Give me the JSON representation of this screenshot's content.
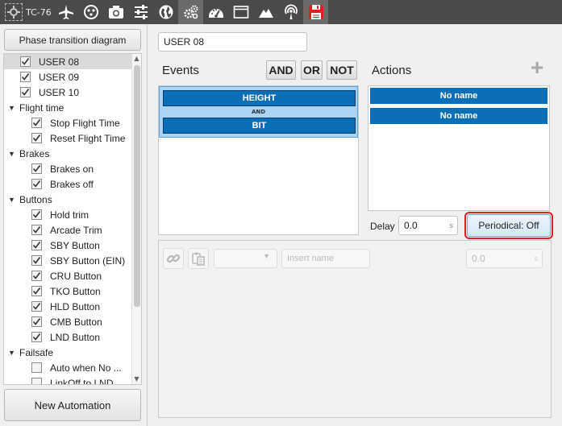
{
  "toolbar": {
    "app_name": "TC-76",
    "icons": [
      "airplane-icon",
      "circle-dots-icon",
      "camera-icon",
      "sliders-icon",
      "globe-icon",
      "gears-icon",
      "gauge-icon",
      "window-icon",
      "mountain-icon",
      "antenna-icon",
      "save-icon"
    ],
    "accent_save": "#e02020"
  },
  "left": {
    "phase_button": "Phase transition diagram",
    "new_automation": "New Automation",
    "tree": [
      {
        "type": "item",
        "label": "USER 08",
        "checked": true,
        "selected": true
      },
      {
        "type": "item",
        "label": "USER 09",
        "checked": true
      },
      {
        "type": "item",
        "label": "USER 10",
        "checked": true
      },
      {
        "type": "group",
        "label": "Flight time"
      },
      {
        "type": "subitem",
        "label": "Stop Flight Time",
        "checked": true
      },
      {
        "type": "subitem",
        "label": "Reset Flight Time",
        "checked": true
      },
      {
        "type": "group",
        "label": "Brakes"
      },
      {
        "type": "subitem",
        "label": "Brakes on",
        "checked": true
      },
      {
        "type": "subitem",
        "label": "Brakes off",
        "checked": true
      },
      {
        "type": "group",
        "label": "Buttons"
      },
      {
        "type": "subitem",
        "label": "Hold trim",
        "checked": true
      },
      {
        "type": "subitem",
        "label": "Arcade Trim",
        "checked": true
      },
      {
        "type": "subitem",
        "label": "SBY Button",
        "checked": true
      },
      {
        "type": "subitem",
        "label": "SBY Button (EIN)",
        "checked": true
      },
      {
        "type": "subitem",
        "label": "CRU Button",
        "checked": true
      },
      {
        "type": "subitem",
        "label": "TKO Button",
        "checked": true
      },
      {
        "type": "subitem",
        "label": "HLD Button",
        "checked": true
      },
      {
        "type": "subitem",
        "label": "CMB Button",
        "checked": true
      },
      {
        "type": "subitem",
        "label": "LND Button",
        "checked": true
      },
      {
        "type": "group",
        "label": "Failsafe"
      },
      {
        "type": "subitem",
        "label": "Auto when No ...",
        "checked": false
      },
      {
        "type": "subitem",
        "label": "LinkOff to LND",
        "checked": false
      }
    ]
  },
  "right": {
    "name_value": "USER 08",
    "events_title": "Events",
    "and_label": "AND",
    "or_label": "OR",
    "not_label": "NOT",
    "events": [
      "HEIGHT",
      "BIT"
    ],
    "event_operator": "AND",
    "actions_title": "Actions",
    "add_symbol": "+",
    "actions": [
      "No name",
      "No name"
    ],
    "delay_label": "Delay",
    "delay_value": "0.0",
    "delay_unit": "s",
    "periodical_label": "Periodical: Off",
    "insert_name_placeholder": "Insert name",
    "bottom_value": "0.0",
    "bottom_unit": "s",
    "colors": {
      "event_blue": "#0b6fb8",
      "group_bg": "#a9d4f5",
      "highlight": "#e02020"
    }
  }
}
